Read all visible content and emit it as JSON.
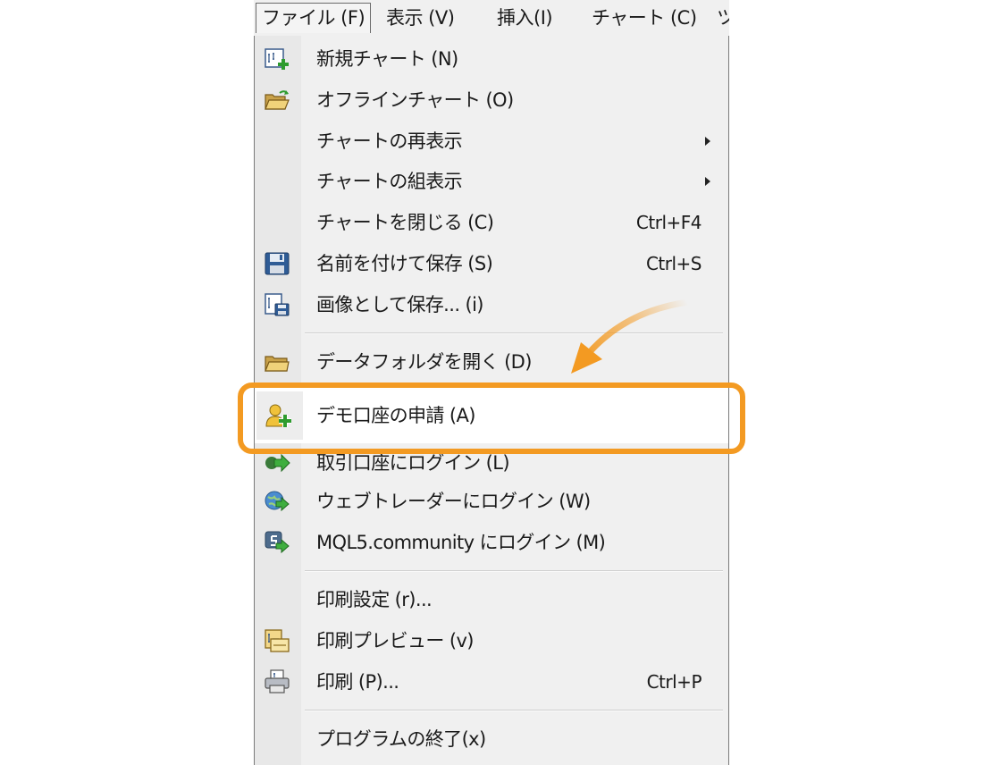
{
  "menubar": {
    "items": [
      {
        "label": "ファイル (F)"
      },
      {
        "label": "表示 (V)"
      },
      {
        "label": "挿入(I)"
      },
      {
        "label": "チャート (C)"
      },
      {
        "label": "ツ"
      }
    ]
  },
  "menu": {
    "new_chart": {
      "label": "新規チャート (N)",
      "icon": "new-chart-icon"
    },
    "offline_chart": {
      "label": "オフラインチャート (O)",
      "icon": "open-folder-icon"
    },
    "redisplay_chart": {
      "label": "チャートの再表示",
      "icon": ""
    },
    "chart_set": {
      "label": "チャートの組表示",
      "icon": ""
    },
    "close_chart": {
      "label": "チャートを閉じる (C)",
      "shortcut": "Ctrl+F4"
    },
    "save_as": {
      "label": "名前を付けて保存 (S)",
      "shortcut": "Ctrl+S",
      "icon": "floppy-disk-icon"
    },
    "save_image": {
      "label": "画像として保存... (i)",
      "icon": "save-image-icon"
    },
    "open_data_folder": {
      "label": "データフォルダを開く (D)",
      "icon": "folder-icon"
    },
    "demo_account": {
      "label": "デモ口座の申請 (A)",
      "icon": "user-add-icon"
    },
    "trade_login": {
      "label": "取引口座にログイン (L)",
      "icon": "login-arrow-icon"
    },
    "webtrader_login": {
      "label": "ウェブトレーダーにログイン (W)",
      "icon": "globe-arrow-icon"
    },
    "mql5_login": {
      "label": "MQL5.community にログイン (M)",
      "icon": "mql5-icon"
    },
    "print_setup": {
      "label": "印刷設定 (r)..."
    },
    "print_preview": {
      "label": "印刷プレビュー (v)",
      "icon": "print-preview-icon"
    },
    "print": {
      "label": "印刷 (P)...",
      "shortcut": "Ctrl+P",
      "icon": "printer-icon"
    },
    "exit": {
      "label": "プログラムの終了(x)"
    }
  },
  "colors": {
    "highlight_frame": "#f39a22",
    "menu_background": "#f0f0f0",
    "icon_gutter": "#e8e8e8"
  }
}
